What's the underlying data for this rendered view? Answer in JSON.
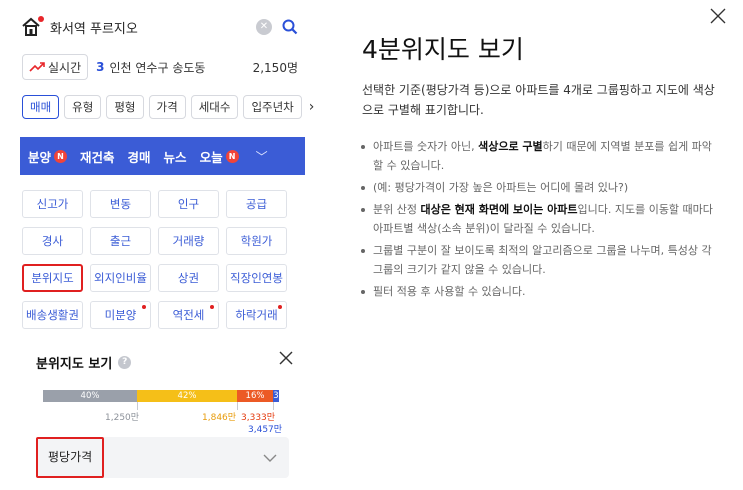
{
  "search": {
    "text": "화서역 푸르지오"
  },
  "realtime": {
    "label": "실시간",
    "rank": "3",
    "place": "인천 연수구 송도동",
    "count": "2,150명"
  },
  "filters": [
    "매매",
    "유형",
    "평형",
    "가격",
    "세대수",
    "입주년차"
  ],
  "nav": {
    "items": [
      {
        "label": "분양",
        "badge": "N"
      },
      {
        "label": "재건축"
      },
      {
        "label": "경매"
      },
      {
        "label": "뉴스"
      },
      {
        "label": "오늘",
        "badge": "N"
      }
    ]
  },
  "grid": [
    "신고가",
    "변동",
    "인구",
    "공급",
    "경사",
    "출근",
    "거래량",
    "학원가",
    "분위지도",
    "외지인비율",
    "상권",
    "직장인연봉",
    "배송생활권",
    "미분양",
    "역전세",
    "하락거래"
  ],
  "quartile": {
    "title": "분위지도 보기",
    "segments": [
      {
        "label": "40%",
        "share": 40,
        "color": "#9aa0aa"
      },
      {
        "label": "42%",
        "share": 42,
        "color": "#f5bf18"
      },
      {
        "label": "16%",
        "share": 16,
        "color": "#ec5a25"
      },
      {
        "label": "3",
        "share": 2,
        "color": "#3b5cd6"
      }
    ],
    "values": [
      "1,250만",
      "1,846만",
      "3,333만",
      "3,457만"
    ],
    "dropdown": "평당가격"
  },
  "info": {
    "title": "4분위지도 보기",
    "desc": "선택한 기준(평당가격 등)으로 아파트를 4개로 그룹핑하고 지도에 색상으로 구별해 표기합니다.",
    "b1_pre": "아파트를 숫자가 아닌, ",
    "b1_bold": "색상으로 구별",
    "b1_post": "하기 때문에 지역별 분포를 쉽게 파악할 수 있습니다.",
    "b2": "(예: 평당가격이 가장 높은 아파트는 어디에 몰려 있나?)",
    "b3_pre": "분위 산정 ",
    "b3_bold": "대상은 현재 화면에 보이는 아파트",
    "b3_post": "입니다. 지도를 이동할 때마다 아파트별 색상(소속 분위)이 달라질 수 있습니다.",
    "b4": "그룹별 구분이 잘 보이도록 최적의 알고리즘으로 그룹을 나누며, 특성상 각 그룹의 크기가 같지 않을 수 있습니다.",
    "b5": "필터 적용 후 사용할 수 있습니다."
  },
  "icons": {
    "home": "home-icon",
    "search": "search-icon",
    "close": "close-icon",
    "trend": "trend-up-icon"
  },
  "colors": {
    "accent": "#3b5cd6",
    "highlight": "#e02020",
    "badge": "#f0443a"
  }
}
